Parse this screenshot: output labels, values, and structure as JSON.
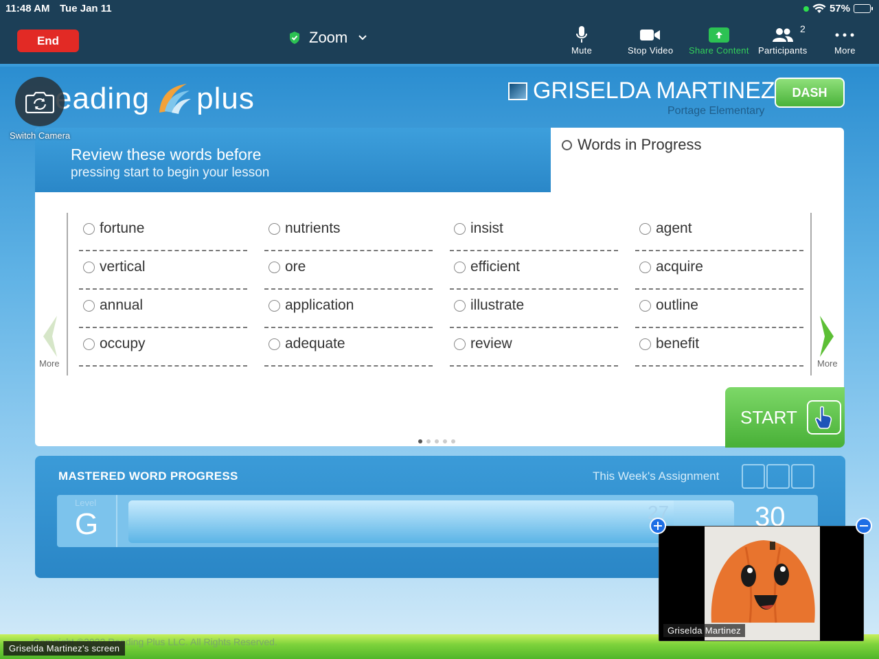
{
  "status_bar": {
    "time": "11:48 AM",
    "date": "Tue Jan 11",
    "battery": "57%",
    "battery_level": 0.57
  },
  "toolbar": {
    "end_label": "End",
    "meeting_title": "Zoom",
    "mute_label": "Mute",
    "stop_video_label": "Stop Video",
    "share_label": "Share Content",
    "participants_label": "Participants",
    "participants_count": "2",
    "more_label": "More",
    "share_color": "#2cc253",
    "end_color": "#e22a25"
  },
  "app": {
    "logo_text_partial": "eading",
    "logo_text_plus": "plus",
    "student_name": "GRISELDA MARTINEZ",
    "school": "Portage Elementary",
    "dash_label": "DASH"
  },
  "lesson": {
    "instruction_line1": "Review these words before",
    "instruction_line2": "pressing start to begin your lesson",
    "progress_tab": "Words in Progress",
    "prev_label": "More",
    "next_label": "More",
    "start_label": "START",
    "page_count": 5,
    "current_page": 1,
    "words": [
      [
        "fortune",
        "nutrients",
        "insist",
        "agent"
      ],
      [
        "vertical",
        "ore",
        "efficient",
        "acquire"
      ],
      [
        "annual",
        "application",
        "illustrate",
        "outline"
      ],
      [
        "occupy",
        "adequate",
        "review",
        "benefit"
      ]
    ]
  },
  "mastered": {
    "title": "MASTERED WORD PROGRESS",
    "assignment_label": "This Week's Assignment",
    "level_label": "Level",
    "level": "G",
    "count": "27",
    "goal": "30",
    "progress": 0.9
  },
  "footer": {
    "copyright": "Copyright ©2022 Reading Plus LLC. All Rights Reserved."
  },
  "overlay": {
    "switch_camera_label": "Switch Camera",
    "video_name": "Griselda Martinez",
    "screen_label": "Griselda Martinez's screen"
  }
}
